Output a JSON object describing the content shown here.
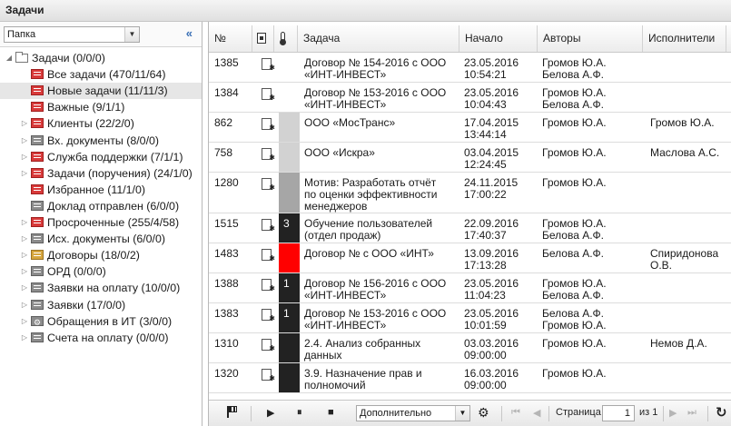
{
  "window": {
    "title": "Задачи"
  },
  "left_panel": {
    "folder_select": "Папка",
    "collapse_glyph": "«",
    "tree": [
      {
        "label": "Задачи (0/0/0)",
        "icon": "folder-icon",
        "level": 0,
        "expander": "expanded",
        "selected": false
      },
      {
        "label": "Все задачи (470/11/64)",
        "icon": "task-list-red-icon",
        "level": 1,
        "expander": "none",
        "selected": false
      },
      {
        "label": "Новые задачи (11/11/3)",
        "icon": "task-list-red-icon",
        "level": 1,
        "expander": "none",
        "selected": true
      },
      {
        "label": "Важные (9/1/1)",
        "icon": "task-list-red-icon",
        "level": 1,
        "expander": "none",
        "selected": false
      },
      {
        "label": "Клиенты (22/2/0)",
        "icon": "task-list-red-icon",
        "level": 1,
        "expander": "collapsed",
        "selected": false
      },
      {
        "label": "Вх. документы (8/0/0)",
        "icon": "task-list-gray-icon",
        "level": 1,
        "expander": "collapsed",
        "selected": false
      },
      {
        "label": "Служба поддержки (7/1/1)",
        "icon": "task-list-red-icon",
        "level": 1,
        "expander": "collapsed",
        "selected": false
      },
      {
        "label": "Задачи (поручения) (24/1/0)",
        "icon": "task-list-red-icon",
        "level": 1,
        "expander": "collapsed",
        "selected": false
      },
      {
        "label": "Избранное (11/1/0)",
        "icon": "task-list-red-icon",
        "level": 1,
        "expander": "none",
        "selected": false
      },
      {
        "label": "Доклад отправлен (6/0/0)",
        "icon": "task-list-gray-icon",
        "level": 1,
        "expander": "none",
        "selected": false
      },
      {
        "label": "Просроченные (255/4/58)",
        "icon": "task-list-red-icon",
        "level": 1,
        "expander": "collapsed",
        "selected": false
      },
      {
        "label": "Исх. документы (6/0/0)",
        "icon": "task-list-gray-icon",
        "level": 1,
        "expander": "collapsed",
        "selected": false
      },
      {
        "label": "Договоры (18/0/2)",
        "icon": "task-list-yellow-icon",
        "level": 1,
        "expander": "collapsed",
        "selected": false
      },
      {
        "label": "ОРД (0/0/0)",
        "icon": "task-list-gray-icon",
        "level": 1,
        "expander": "collapsed",
        "selected": false
      },
      {
        "label": "Заявки на оплату (10/0/0)",
        "icon": "task-list-gray-icon",
        "level": 1,
        "expander": "collapsed",
        "selected": false
      },
      {
        "label": "Заявки (17/0/0)",
        "icon": "task-list-gray-icon",
        "level": 1,
        "expander": "collapsed",
        "selected": false
      },
      {
        "label": "Обращения в ИТ (3/0/0)",
        "icon": "gear-icon",
        "level": 1,
        "expander": "collapsed",
        "selected": false
      },
      {
        "label": "Счета на оплату (0/0/0)",
        "icon": "task-list-gray-icon",
        "level": 1,
        "expander": "collapsed",
        "selected": false
      }
    ]
  },
  "grid": {
    "columns": {
      "num": "№",
      "doc": "document-icon",
      "priority": "thermometer-icon",
      "task": "Задача",
      "start": "Начало",
      "authors": "Авторы",
      "executors": "Исполнители"
    },
    "rows": [
      {
        "num": "1385",
        "priority_label": "",
        "priority_color": "#ffffff",
        "task": [
          "Договор № 154-2016 с ООО",
          "«ИНТ-ИНВЕСТ»"
        ],
        "start": [
          "23.05.2016",
          "10:54:21"
        ],
        "authors": [
          "Громов Ю.А.",
          "Белова А.Ф."
        ],
        "executors": []
      },
      {
        "num": "1384",
        "priority_label": "",
        "priority_color": "#ffffff",
        "task": [
          "Договор № 153-2016 с ООО",
          "«ИНТ-ИНВЕСТ»"
        ],
        "start": [
          "23.05.2016",
          "10:04:43"
        ],
        "authors": [
          "Громов Ю.А.",
          "Белова А.Ф."
        ],
        "executors": []
      },
      {
        "num": "862",
        "priority_label": "",
        "priority_color": "#d2d2d2",
        "task": [
          "ООО «МосТранс»"
        ],
        "start": [
          "17.04.2015",
          "13:44:14"
        ],
        "authors": [
          "Громов Ю.А."
        ],
        "executors": [
          "Громов Ю.А."
        ]
      },
      {
        "num": "758",
        "priority_label": "",
        "priority_color": "#d2d2d2",
        "task": [
          "ООО «Искра»"
        ],
        "start": [
          "03.04.2015",
          "12:24:45"
        ],
        "authors": [
          "Громов Ю.А."
        ],
        "executors": [
          "Маслова А.С."
        ]
      },
      {
        "num": "1280",
        "priority_label": "",
        "priority_color": "#a6a6a6",
        "task": [
          "Мотив: Разработать отчёт",
          "по оценки эффективности",
          "менеджеров"
        ],
        "start": [
          "24.11.2015",
          "17:00:22"
        ],
        "authors": [
          "Громов Ю.А."
        ],
        "executors": []
      },
      {
        "num": "1515",
        "priority_label": "3",
        "priority_color": "#222222",
        "task": [
          "Обучение пользователей",
          "(отдел продаж)"
        ],
        "start": [
          "22.09.2016",
          "17:40:37"
        ],
        "authors": [
          "Громов Ю.А.",
          "Белова А.Ф."
        ],
        "executors": []
      },
      {
        "num": "1483",
        "priority_label": "",
        "priority_color": "#ff0000",
        "task": [
          "Договор № с ООО «ИНТ»"
        ],
        "start": [
          "13.09.2016",
          "17:13:28"
        ],
        "authors": [
          "Белова А.Ф."
        ],
        "executors": [
          "Спиридонова",
          "О.В."
        ]
      },
      {
        "num": "1388",
        "priority_label": "1",
        "priority_color": "#222222",
        "task": [
          "Договор № 156-2016 с ООО",
          "«ИНТ-ИНВЕСТ»"
        ],
        "start": [
          "23.05.2016",
          "11:04:23"
        ],
        "authors": [
          "Громов Ю.А.",
          "Белова А.Ф."
        ],
        "executors": []
      },
      {
        "num": "1383",
        "priority_label": "1",
        "priority_color": "#222222",
        "task": [
          "Договор № 153-2016 с ООО",
          "«ИНТ-ИНВЕСТ»"
        ],
        "start": [
          "23.05.2016",
          "10:01:59"
        ],
        "authors": [
          "Белова А.Ф.",
          "Громов Ю.А."
        ],
        "executors": []
      },
      {
        "num": "1310",
        "priority_label": "",
        "priority_color": "#222222",
        "task": [
          "2.4. Анализ собранных",
          "данных"
        ],
        "start": [
          "03.03.2016",
          "09:00:00"
        ],
        "authors": [
          "Громов Ю.А."
        ],
        "executors": [
          "Немов Д.А."
        ]
      },
      {
        "num": "1320",
        "priority_label": "",
        "priority_color": "#222222",
        "task": [
          "3.9. Назначение прав и",
          "полномочий"
        ],
        "start": [
          "16.03.2016",
          "09:00:00"
        ],
        "authors": [
          "Громов Ю.А."
        ],
        "executors": []
      }
    ]
  },
  "bottom_toolbar": {
    "flag_icon": "flag-icon",
    "play_glyph": "▶",
    "pause_glyph": "⏸",
    "stop_glyph": "■",
    "more_select": "Дополнительно",
    "page_label": "Страница",
    "page_value": "1",
    "page_of": "из 1",
    "first_glyph": "⏮",
    "prev_glyph": "◀",
    "next_glyph": "▶",
    "last_glyph": "⏭",
    "refresh_glyph": "↻"
  }
}
